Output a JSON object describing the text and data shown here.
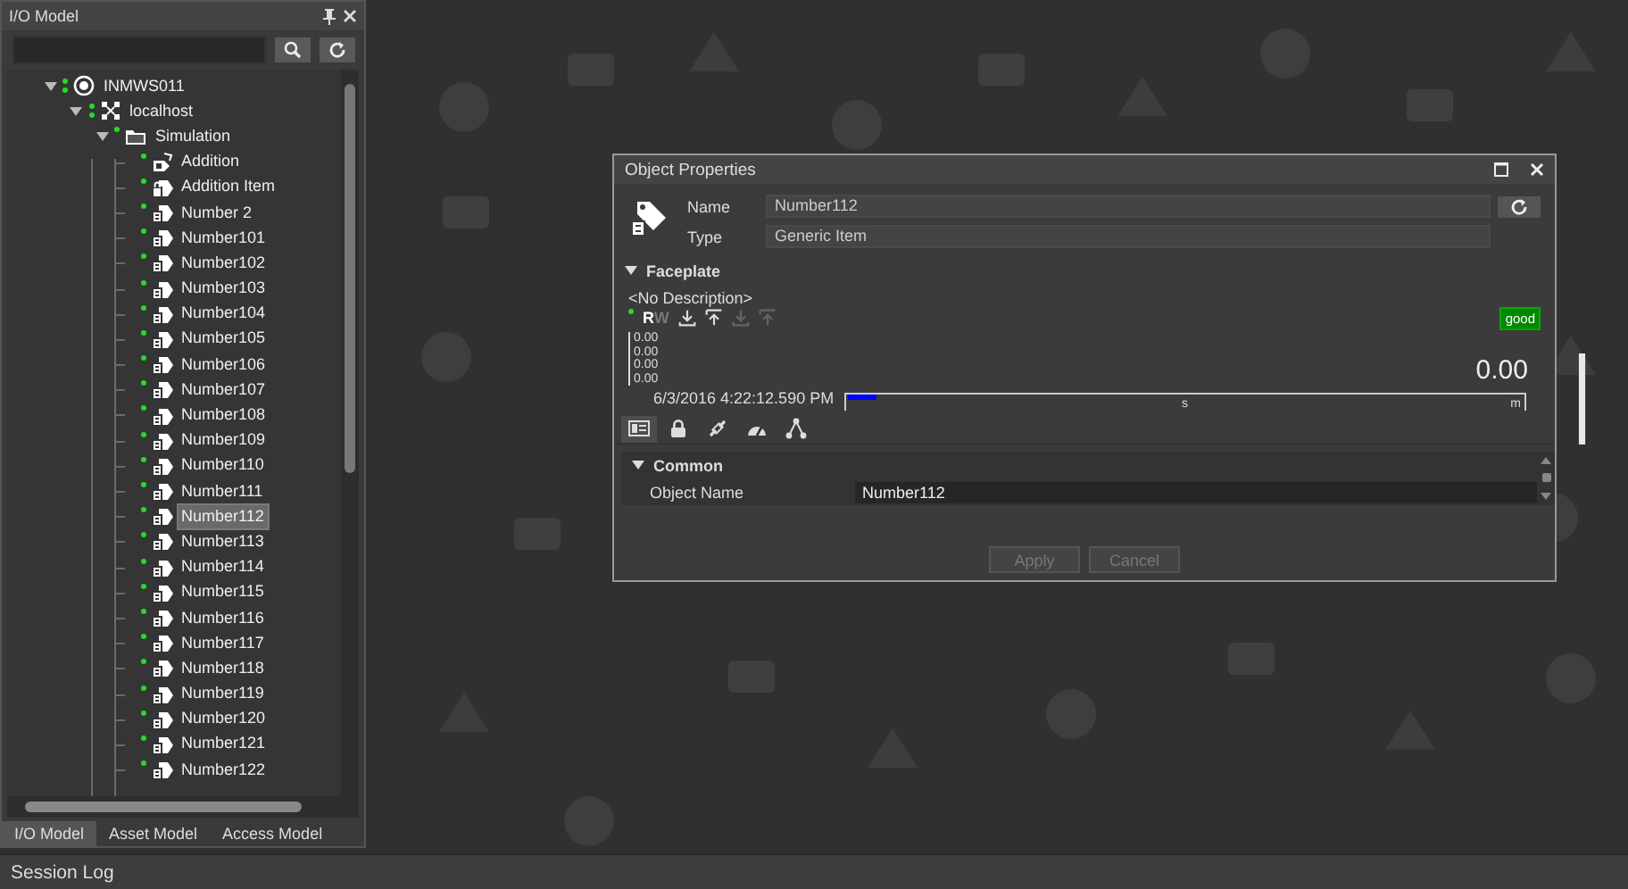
{
  "io_panel": {
    "title": "I/O Model",
    "tree": [
      {
        "label": "INMWS011",
        "kind": "station",
        "expanded": true,
        "selected": false,
        "children": [
          {
            "label": "localhost",
            "kind": "host",
            "expanded": true,
            "selected": false,
            "children": [
              {
                "label": "Simulation",
                "kind": "folder",
                "expanded": true,
                "selected": false,
                "children": [
                  {
                    "label": "Addition",
                    "kind": "calc",
                    "selected": false
                  },
                  {
                    "label": "Addition Item",
                    "kind": "locked-tag",
                    "selected": false
                  },
                  {
                    "label": "Number 2",
                    "kind": "tag",
                    "selected": false
                  },
                  {
                    "label": "Number101",
                    "kind": "tag",
                    "selected": false
                  },
                  {
                    "label": "Number102",
                    "kind": "tag",
                    "selected": false
                  },
                  {
                    "label": "Number103",
                    "kind": "tag",
                    "selected": false
                  },
                  {
                    "label": "Number104",
                    "kind": "tag",
                    "selected": false
                  },
                  {
                    "label": "Number105",
                    "kind": "tag",
                    "selected": false
                  },
                  {
                    "label": "Number106",
                    "kind": "tag",
                    "selected": false
                  },
                  {
                    "label": "Number107",
                    "kind": "tag",
                    "selected": false
                  },
                  {
                    "label": "Number108",
                    "kind": "tag",
                    "selected": false
                  },
                  {
                    "label": "Number109",
                    "kind": "tag",
                    "selected": false
                  },
                  {
                    "label": "Number110",
                    "kind": "tag",
                    "selected": false
                  },
                  {
                    "label": "Number111",
                    "kind": "tag",
                    "selected": false
                  },
                  {
                    "label": "Number112",
                    "kind": "tag",
                    "selected": true
                  },
                  {
                    "label": "Number113",
                    "kind": "tag",
                    "selected": false
                  },
                  {
                    "label": "Number114",
                    "kind": "tag",
                    "selected": false
                  },
                  {
                    "label": "Number115",
                    "kind": "tag",
                    "selected": false
                  },
                  {
                    "label": "Number116",
                    "kind": "tag",
                    "selected": false
                  },
                  {
                    "label": "Number117",
                    "kind": "tag",
                    "selected": false
                  },
                  {
                    "label": "Number118",
                    "kind": "tag",
                    "selected": false
                  },
                  {
                    "label": "Number119",
                    "kind": "tag",
                    "selected": false
                  },
                  {
                    "label": "Number120",
                    "kind": "tag",
                    "selected": false
                  },
                  {
                    "label": "Number121",
                    "kind": "tag",
                    "selected": false
                  },
                  {
                    "label": "Number122",
                    "kind": "tag",
                    "selected": false
                  }
                ]
              }
            ]
          }
        ]
      }
    ],
    "tabs": [
      {
        "label": "I/O Model",
        "selected": true
      },
      {
        "label": "Asset Model",
        "selected": false
      },
      {
        "label": "Access Model",
        "selected": false
      }
    ]
  },
  "background_text": "I",
  "dialog": {
    "title": "Object Properties",
    "name_label": "Name",
    "name_value": "Number112",
    "type_label": "Type",
    "type_value": "Generic Item",
    "faceplate": {
      "header": "Faceplate",
      "expanded": true,
      "description": "<No Description>",
      "access": [
        {
          "label": "R",
          "on": true
        },
        {
          "label": "W",
          "on": false
        }
      ],
      "actions": [
        {
          "kind": "download",
          "enabled": true
        },
        {
          "kind": "upload",
          "enabled": true
        },
        {
          "kind": "download",
          "enabled": false
        },
        {
          "kind": "upload",
          "enabled": false
        }
      ],
      "quality": "good",
      "scale": [
        "0.00",
        "0.00",
        "0.00",
        "0.00"
      ],
      "value": "0.00",
      "timestamp": "6/3/2016 4:22:12.590 PM",
      "timeline_ticks": [
        "s",
        "m"
      ]
    },
    "tabs": [
      {
        "kind": "general",
        "selected": true
      },
      {
        "kind": "security",
        "selected": false
      },
      {
        "kind": "link",
        "selected": false
      },
      {
        "kind": "gauge",
        "selected": false
      },
      {
        "kind": "hierarchy",
        "selected": false
      }
    ],
    "section": {
      "header": "Common",
      "expanded": true,
      "rows": [
        {
          "label": "Object Name",
          "value": "Number112"
        }
      ]
    },
    "buttons": [
      {
        "label": "Apply",
        "disabled": true
      },
      {
        "label": "Cancel",
        "disabled": true
      }
    ]
  },
  "status_bar": {
    "label": "Session Log"
  }
}
